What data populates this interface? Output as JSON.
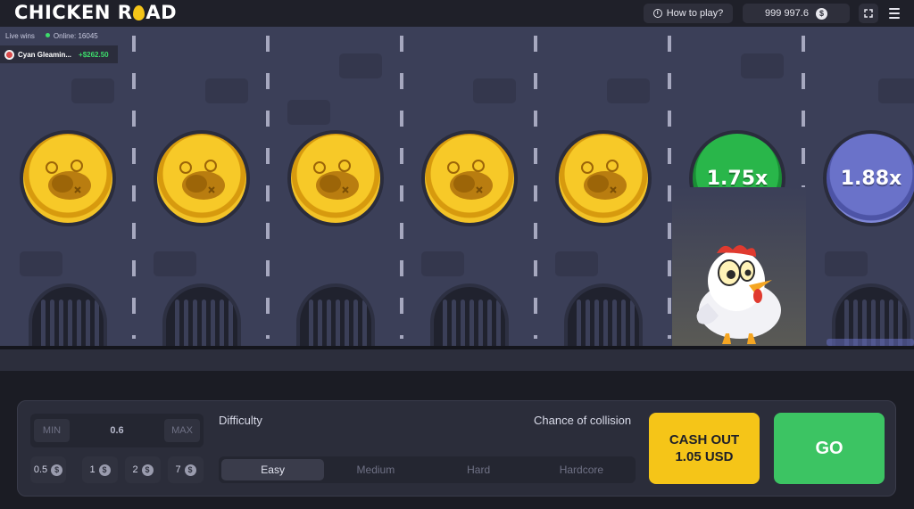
{
  "header": {
    "logo_pre": "CHICKEN R",
    "logo_post": "AD",
    "how_to_play": "How to play?",
    "balance": "999 997.6",
    "currency_icon": "dollar-coin-icon"
  },
  "live_wins": {
    "title": "Live wins",
    "online": "Online: 16045",
    "entry": {
      "name": "Cyan Gleamin...",
      "amount": "+$262.50"
    }
  },
  "lanes": [
    {
      "state": "passed"
    },
    {
      "state": "passed"
    },
    {
      "state": "passed"
    },
    {
      "state": "passed"
    },
    {
      "state": "passed"
    },
    {
      "state": "current",
      "multiplier": "1.75x",
      "color": "#29b64a"
    },
    {
      "state": "next",
      "multiplier": "1.88x",
      "color": "#6a72c9"
    }
  ],
  "controls": {
    "min_label": "MIN",
    "bet_value": "0.6",
    "max_label": "MAX",
    "chips": [
      "0.5",
      "1",
      "2",
      "7"
    ],
    "difficulty_label": "Difficulty",
    "collision_label": "Chance of collision",
    "difficulties": [
      "Easy",
      "Medium",
      "Hard",
      "Hardcore"
    ],
    "selected_difficulty": "Easy",
    "cashout_line1": "CASH OUT",
    "cashout_line2": "1.05 USD",
    "go_label": "GO"
  },
  "colors": {
    "accent_yellow": "#f5c518",
    "go_green": "#3cc463",
    "win_green": "#3ddc6b"
  }
}
